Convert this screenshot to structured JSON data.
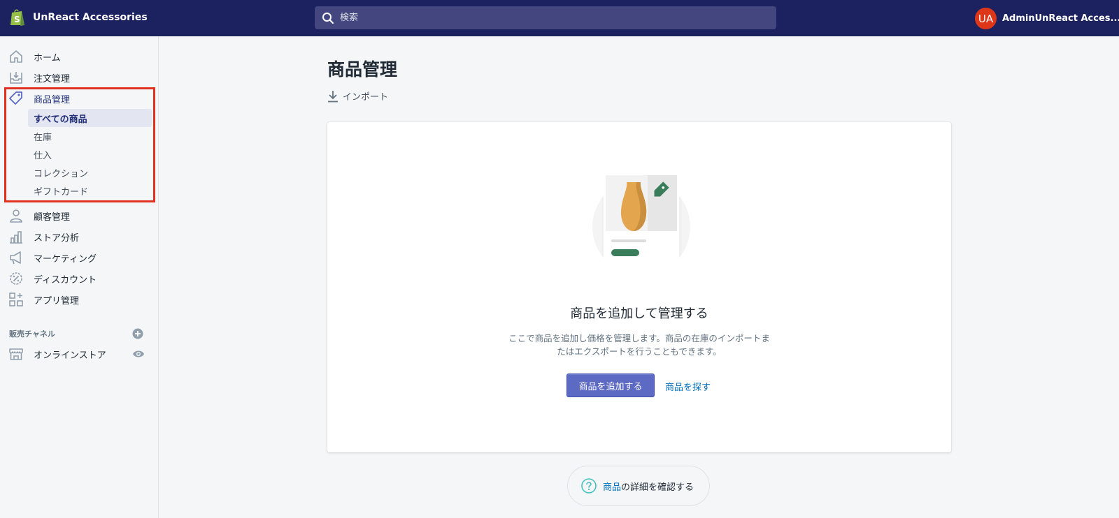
{
  "app": {
    "store_name": "UnReact Accessories"
  },
  "search": {
    "placeholder": "検索"
  },
  "user": {
    "initials": "UA",
    "name": "AdminUnReact Acces..."
  },
  "sidebar": {
    "items": [
      {
        "label": "ホーム"
      },
      {
        "label": "注文管理"
      },
      {
        "label": "商品管理"
      },
      {
        "label": "顧客管理"
      },
      {
        "label": "ストア分析"
      },
      {
        "label": "マーケティング"
      },
      {
        "label": "ディスカウント"
      },
      {
        "label": "アプリ管理"
      }
    ],
    "products_sub": [
      {
        "label": "すべての商品"
      },
      {
        "label": "在庫"
      },
      {
        "label": "仕入"
      },
      {
        "label": "コレクション"
      },
      {
        "label": "ギフトカード"
      }
    ],
    "channels_title": "販売チャネル",
    "online_store": "オンラインストア"
  },
  "main": {
    "title": "商品管理",
    "import_label": "インポート",
    "empty_title": "商品を追加して管理する",
    "empty_desc": "ここで商品を追加し価格を管理します。商品の在庫のインポートまたはエクスポートを行うこともできます。",
    "add_button": "商品を追加する",
    "find_link": "商品を探す",
    "help_link": "商品",
    "help_suffix": "の詳細を確認する"
  },
  "colors": {
    "topbar": "#1c2260",
    "primary": "#5c6ac4",
    "link": "#006fbb",
    "highlight": "#e0301e"
  }
}
